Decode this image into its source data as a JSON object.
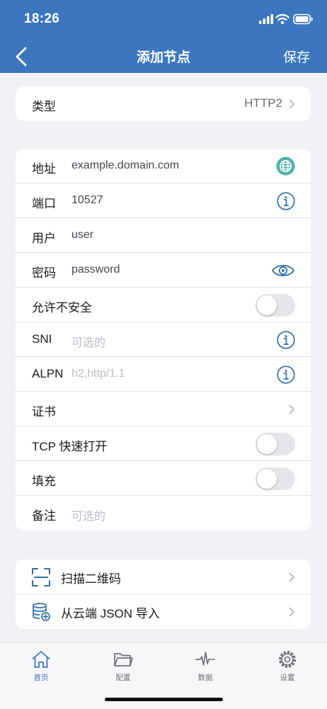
{
  "status_bar": {
    "time": "18:26"
  },
  "nav": {
    "title": "添加节点",
    "save_label": "保存"
  },
  "type_row": {
    "label": "类型",
    "value": "HTTP2"
  },
  "fields": {
    "address": {
      "label": "地址",
      "value": "example.domain.com"
    },
    "port": {
      "label": "端口",
      "value": "10527"
    },
    "user": {
      "label": "用户",
      "value": "user"
    },
    "password": {
      "label": "密码",
      "value": "password"
    },
    "allow_insecure": {
      "label": "允许不安全",
      "on": false
    },
    "sni": {
      "label": "SNI",
      "placeholder": "可选的"
    },
    "alpn": {
      "label": "ALPN",
      "placeholder": "h2,http/1.1"
    },
    "cert": {
      "label": "证书"
    },
    "tcp_fast_open": {
      "label": "TCP 快速打开",
      "on": false
    },
    "padding": {
      "label": "填充",
      "on": false
    },
    "remark": {
      "label": "备注",
      "placeholder": "可选的"
    }
  },
  "actions": [
    {
      "label": "扫描二维码",
      "icon": "qr-scan-icon"
    },
    {
      "label": "从云端 JSON 导入",
      "icon": "database-import-icon"
    }
  ],
  "tabs": [
    {
      "label": "首页",
      "icon": "home-icon",
      "active": true
    },
    {
      "label": "配置",
      "icon": "folder-icon",
      "active": false
    },
    {
      "label": "数据",
      "icon": "pulse-icon",
      "active": false
    },
    {
      "label": "设置",
      "icon": "gear-icon",
      "active": false
    }
  ],
  "colors": {
    "accent": "#3b76bf",
    "icon_blue": "#2f6fa6",
    "globe_teal": "#4fb3a9",
    "background": "#f2f2f6"
  }
}
